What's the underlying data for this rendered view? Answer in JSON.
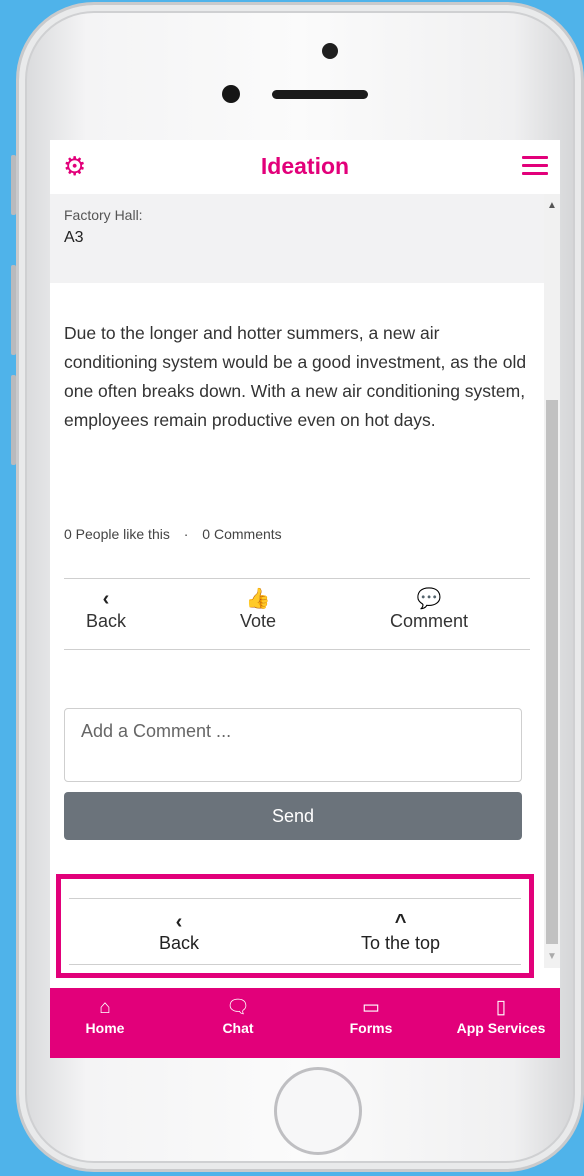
{
  "header": {
    "title": "Ideation",
    "settings_icon": "gear-icon",
    "menu_icon": "hamburger-icon"
  },
  "idea": {
    "field_label": "Factory Hall:",
    "field_value": "A3",
    "description": "Due to the longer and hotter summers, a new air conditioning system would be a good investment, as the old one often breaks down. With a new air conditioning system, employees remain productive even on hot days.",
    "likes_text": "0 People like this",
    "separator": "·",
    "comments_text": "0 Comments"
  },
  "actions": {
    "back_label": "Back",
    "vote_label": "Vote",
    "comment_label": "Comment"
  },
  "comment_form": {
    "placeholder": "Add a Comment ...",
    "send_label": "Send"
  },
  "bottom_nav": {
    "back_label": "Back",
    "top_label": "To the top"
  },
  "tabbar": {
    "home": "Home",
    "chat": "Chat",
    "forms": "Forms",
    "app_services": "App Services"
  },
  "colors": {
    "accent": "#e2007a",
    "button_gray": "#6b737b",
    "background": "#4fb3ea"
  }
}
